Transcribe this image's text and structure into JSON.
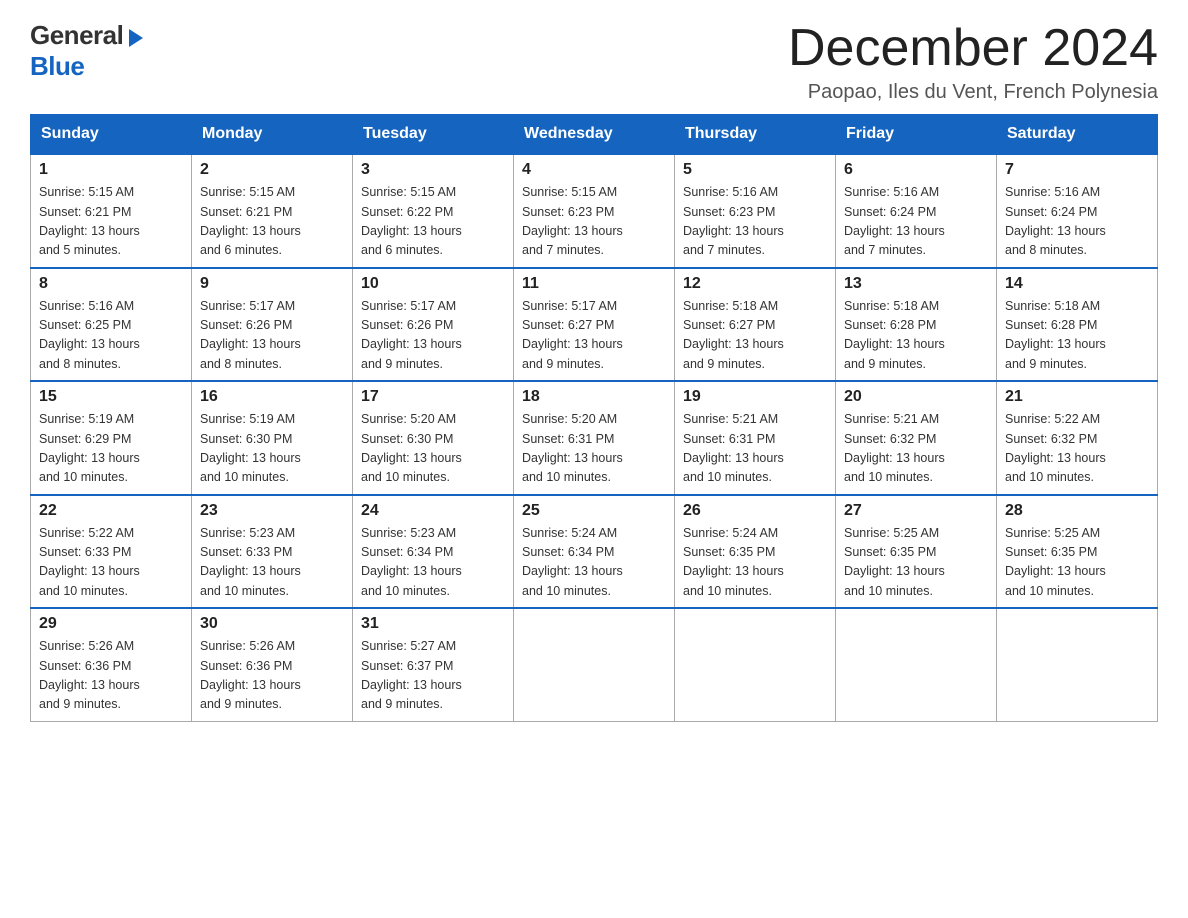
{
  "header": {
    "logo_general": "General",
    "logo_blue": "Blue",
    "month_title": "December 2024",
    "location": "Paopao, Iles du Vent, French Polynesia"
  },
  "weekdays": [
    "Sunday",
    "Monday",
    "Tuesday",
    "Wednesday",
    "Thursday",
    "Friday",
    "Saturday"
  ],
  "weeks": [
    [
      {
        "day": "1",
        "info": "Sunrise: 5:15 AM\nSunset: 6:21 PM\nDaylight: 13 hours\nand 5 minutes."
      },
      {
        "day": "2",
        "info": "Sunrise: 5:15 AM\nSunset: 6:21 PM\nDaylight: 13 hours\nand 6 minutes."
      },
      {
        "day": "3",
        "info": "Sunrise: 5:15 AM\nSunset: 6:22 PM\nDaylight: 13 hours\nand 6 minutes."
      },
      {
        "day": "4",
        "info": "Sunrise: 5:15 AM\nSunset: 6:23 PM\nDaylight: 13 hours\nand 7 minutes."
      },
      {
        "day": "5",
        "info": "Sunrise: 5:16 AM\nSunset: 6:23 PM\nDaylight: 13 hours\nand 7 minutes."
      },
      {
        "day": "6",
        "info": "Sunrise: 5:16 AM\nSunset: 6:24 PM\nDaylight: 13 hours\nand 7 minutes."
      },
      {
        "day": "7",
        "info": "Sunrise: 5:16 AM\nSunset: 6:24 PM\nDaylight: 13 hours\nand 8 minutes."
      }
    ],
    [
      {
        "day": "8",
        "info": "Sunrise: 5:16 AM\nSunset: 6:25 PM\nDaylight: 13 hours\nand 8 minutes."
      },
      {
        "day": "9",
        "info": "Sunrise: 5:17 AM\nSunset: 6:26 PM\nDaylight: 13 hours\nand 8 minutes."
      },
      {
        "day": "10",
        "info": "Sunrise: 5:17 AM\nSunset: 6:26 PM\nDaylight: 13 hours\nand 9 minutes."
      },
      {
        "day": "11",
        "info": "Sunrise: 5:17 AM\nSunset: 6:27 PM\nDaylight: 13 hours\nand 9 minutes."
      },
      {
        "day": "12",
        "info": "Sunrise: 5:18 AM\nSunset: 6:27 PM\nDaylight: 13 hours\nand 9 minutes."
      },
      {
        "day": "13",
        "info": "Sunrise: 5:18 AM\nSunset: 6:28 PM\nDaylight: 13 hours\nand 9 minutes."
      },
      {
        "day": "14",
        "info": "Sunrise: 5:18 AM\nSunset: 6:28 PM\nDaylight: 13 hours\nand 9 minutes."
      }
    ],
    [
      {
        "day": "15",
        "info": "Sunrise: 5:19 AM\nSunset: 6:29 PM\nDaylight: 13 hours\nand 10 minutes."
      },
      {
        "day": "16",
        "info": "Sunrise: 5:19 AM\nSunset: 6:30 PM\nDaylight: 13 hours\nand 10 minutes."
      },
      {
        "day": "17",
        "info": "Sunrise: 5:20 AM\nSunset: 6:30 PM\nDaylight: 13 hours\nand 10 minutes."
      },
      {
        "day": "18",
        "info": "Sunrise: 5:20 AM\nSunset: 6:31 PM\nDaylight: 13 hours\nand 10 minutes."
      },
      {
        "day": "19",
        "info": "Sunrise: 5:21 AM\nSunset: 6:31 PM\nDaylight: 13 hours\nand 10 minutes."
      },
      {
        "day": "20",
        "info": "Sunrise: 5:21 AM\nSunset: 6:32 PM\nDaylight: 13 hours\nand 10 minutes."
      },
      {
        "day": "21",
        "info": "Sunrise: 5:22 AM\nSunset: 6:32 PM\nDaylight: 13 hours\nand 10 minutes."
      }
    ],
    [
      {
        "day": "22",
        "info": "Sunrise: 5:22 AM\nSunset: 6:33 PM\nDaylight: 13 hours\nand 10 minutes."
      },
      {
        "day": "23",
        "info": "Sunrise: 5:23 AM\nSunset: 6:33 PM\nDaylight: 13 hours\nand 10 minutes."
      },
      {
        "day": "24",
        "info": "Sunrise: 5:23 AM\nSunset: 6:34 PM\nDaylight: 13 hours\nand 10 minutes."
      },
      {
        "day": "25",
        "info": "Sunrise: 5:24 AM\nSunset: 6:34 PM\nDaylight: 13 hours\nand 10 minutes."
      },
      {
        "day": "26",
        "info": "Sunrise: 5:24 AM\nSunset: 6:35 PM\nDaylight: 13 hours\nand 10 minutes."
      },
      {
        "day": "27",
        "info": "Sunrise: 5:25 AM\nSunset: 6:35 PM\nDaylight: 13 hours\nand 10 minutes."
      },
      {
        "day": "28",
        "info": "Sunrise: 5:25 AM\nSunset: 6:35 PM\nDaylight: 13 hours\nand 10 minutes."
      }
    ],
    [
      {
        "day": "29",
        "info": "Sunrise: 5:26 AM\nSunset: 6:36 PM\nDaylight: 13 hours\nand 9 minutes."
      },
      {
        "day": "30",
        "info": "Sunrise: 5:26 AM\nSunset: 6:36 PM\nDaylight: 13 hours\nand 9 minutes."
      },
      {
        "day": "31",
        "info": "Sunrise: 5:27 AM\nSunset: 6:37 PM\nDaylight: 13 hours\nand 9 minutes."
      },
      {
        "day": "",
        "info": ""
      },
      {
        "day": "",
        "info": ""
      },
      {
        "day": "",
        "info": ""
      },
      {
        "day": "",
        "info": ""
      }
    ]
  ]
}
